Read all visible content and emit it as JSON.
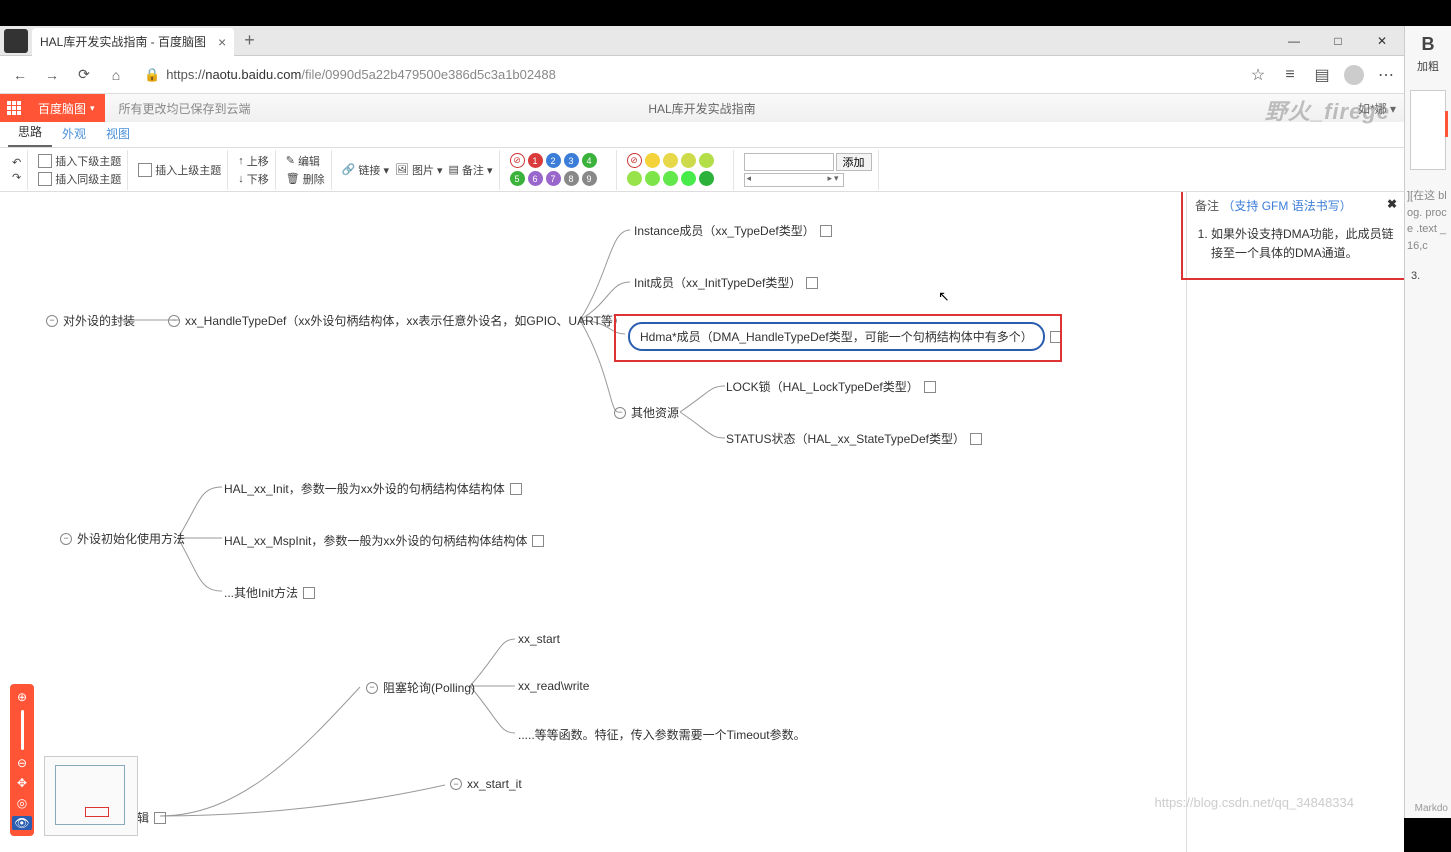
{
  "browser": {
    "tab_title": "HAL库开发实战指南 - 百度脑图",
    "url_host": "naotu.baidu.com",
    "url_path": "/file/0990d5a22b479500e386d5c3a1b02488",
    "url_full": "https://naotu.baidu.com/file/0990d5a22b479500e386d5c3a1b02488"
  },
  "header": {
    "brand": "百度脑图",
    "save_status": "所有更改均已保存到云端",
    "doc_title": "HAL库开发实战指南",
    "watermark": "野火_firege",
    "user_label": "如*娜 ▾"
  },
  "view_tabs": {
    "t0": "思路",
    "t1": "外观",
    "t2": "视图"
  },
  "toolbar": {
    "undo": "↶",
    "redo": "↷",
    "insert_child": "插入下级主题",
    "insert_parent": "插入上级主题",
    "insert_sibling": "插入同级主题",
    "move_up": "上移",
    "move_down": "下移",
    "edit": "编辑",
    "delete": "删除",
    "link": "链接 ▾",
    "image": "图片 ▾",
    "note": "备注 ▾",
    "priority_clear": "⊘",
    "priority": [
      "1",
      "2",
      "3",
      "4",
      "5",
      "6",
      "7",
      "8",
      "9"
    ],
    "progress_clear": "⊘",
    "tag_add": "添加"
  },
  "priority_colors": [
    "#d93b3b",
    "#3b7dd8",
    "#3b7dd8",
    "#3bb23b",
    "#3bb23b",
    "#9966cc",
    "#9966cc",
    "#888888",
    "#888888"
  ],
  "progress_colors": [
    "#f3d23a",
    "#e7d84a",
    "#cddb4a",
    "#b3de4a",
    "#98e24a",
    "#7de54a",
    "#62e84a",
    "#47ec4a",
    "#2cb23b"
  ],
  "nodes": {
    "n1": "对外设的封装",
    "n2": "xx_HandleTypeDef（xx外设句柄结构体，xx表示任意外设名，如GPIO、UART等）",
    "n3": "Instance成员（xx_TypeDef类型）",
    "n4": "Init成员（xx_InitTypeDef类型）",
    "n5": "Hdma*成员（DMA_HandleTypeDef类型，可能一个句柄结构体中有多个）",
    "n6": "其他资源",
    "n7": "LOCK锁（HAL_LockTypeDef类型）",
    "n8": "STATUS状态（HAL_xx_StateTypeDef类型）",
    "n9": "外设初始化使用方法",
    "n10": "HAL_xx_Init，参数一般为xx外设的句柄结构体结构体",
    "n11": "HAL_xx_MspInit，参数一般为xx外设的句柄结构体结构体",
    "n12": "...其他Init方法",
    "n13": "阻塞轮询(Polling)",
    "n14": "xx_start",
    "n15": "xx_read\\write",
    "n16": ".....等等函数。特征，传入参数需要一个Timeout参数。",
    "n17": "xx_start_it",
    "n18": "外设使用逻辑"
  },
  "notes": {
    "title": "备注",
    "gfm_link": "（支持 GFM 语法书写）",
    "item1": "如果外设支持DMA功能，此成员链接至一个具体的DMA通道。"
  },
  "side": {
    "bold": "B",
    "bold_label": "加粗",
    "lines": "][在这\nblog.\nproce\n.text\n_16,c",
    "num3": "3.",
    "footer": "Markdo"
  },
  "blog_watermark": "https://blog.csdn.net/qq_34848334"
}
